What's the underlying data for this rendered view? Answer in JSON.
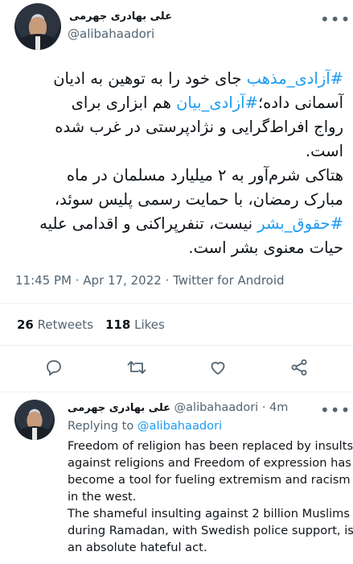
{
  "tweet": {
    "author_name": "علی بهادری جهرمی",
    "author_handle": "@alibahaadori",
    "more_label": "•••",
    "line1_tag1": "#آزادی_مذهب",
    "line1_rest": " جای خود را به توهین به ادیان",
    "line2_pre": "آسمانی داده؛",
    "line2_tag": "#آزادی_بیان",
    "line2_post": " هم ابزاری برای",
    "line3": "رواج افراط‌گرایی و نژادپرستی در غرب شده",
    "line4": "است.",
    "line5": "هتاکی شرم‌آور به ۲ میلیارد مسلمان در ماه",
    "line6": "مبارک رمضان، با حمایت رسمی پلیس سوئد،",
    "line7_tag": "#حقوق_بشر",
    "line7_rest": " نیست، تنفرپراکنی و اقدامی علیه",
    "line8": "حیات معنوی بشر است.",
    "timestamp": "11:45 PM · Apr 17, 2022 · Twitter for Android",
    "retweets_count": "26",
    "retweets_label": "Retweets",
    "likes_count": "118",
    "likes_label": "Likes"
  },
  "actions": {
    "reply_icon": "reply-icon",
    "retweet_icon": "retweet-icon",
    "like_icon": "heart-icon",
    "share_icon": "share-icon"
  },
  "reply": {
    "author_name": "علی بهادری جهرمی",
    "author_handle": "@alibahaadori",
    "age": "· 4m",
    "more_label": "•••",
    "replying_prefix": "Replying to ",
    "replying_handle": "@alibahaadori",
    "lines": [
      "Freedom of religion has been replaced by insults",
      "against religions and Freedom of expression has",
      "become a tool for fueling extremism and racism",
      "in the west.",
      "The shameful insulting against 2 billion Muslims",
      "during Ramadan, with Swedish police support, is",
      "an absolute hateful act."
    ]
  },
  "colors": {
    "link": "#1d9bf0",
    "muted": "#536471",
    "text": "#0f1419",
    "divider": "#eff3f4"
  }
}
